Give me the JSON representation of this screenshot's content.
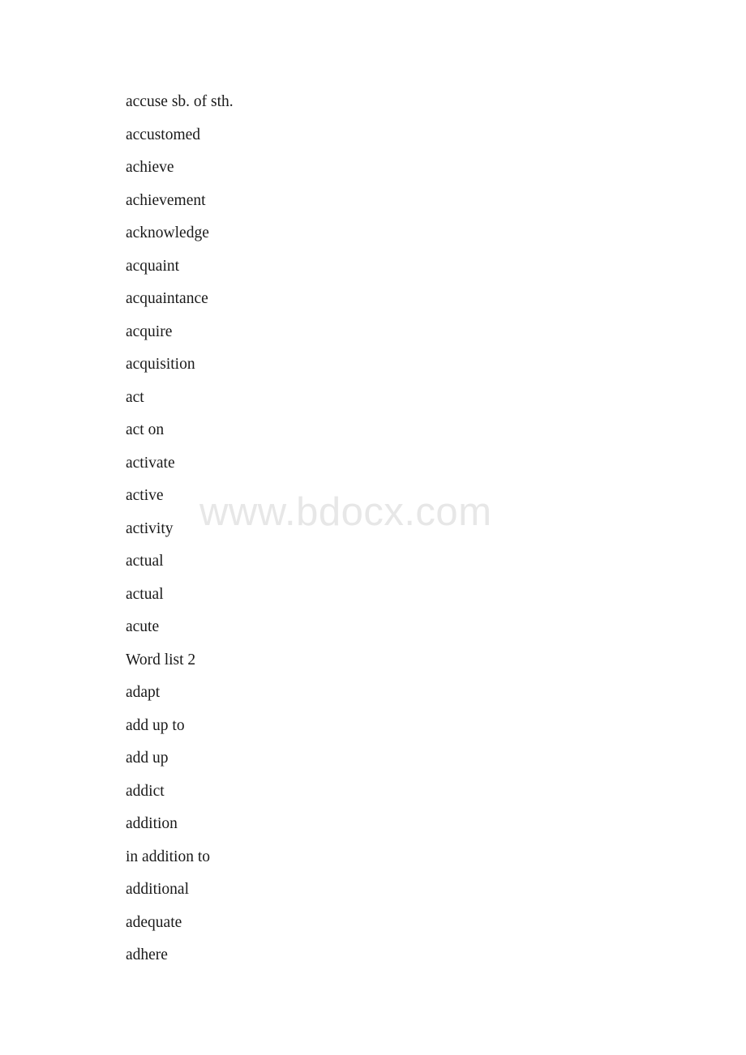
{
  "document": {
    "background_color": "#ffffff",
    "text_color": "#1a1a1a"
  },
  "watermark": {
    "text": "www.bdocx.com",
    "color": "#e7e7e7"
  },
  "word_list": {
    "entries": [
      {
        "text": "accuse sb. of sth."
      },
      {
        "text": "accustomed"
      },
      {
        "text": "achieve"
      },
      {
        "text": "achievement"
      },
      {
        "text": "acknowledge"
      },
      {
        "text": "acquaint"
      },
      {
        "text": "acquaintance"
      },
      {
        "text": "acquire"
      },
      {
        "text": "acquisition"
      },
      {
        "text": "act"
      },
      {
        "text": "act on"
      },
      {
        "text": "activate"
      },
      {
        "text": "active"
      },
      {
        "text": "activity"
      },
      {
        "text": "actual"
      },
      {
        "text": "actual"
      },
      {
        "text": "acute"
      },
      {
        "text": "Word list 2"
      },
      {
        "text": "adapt"
      },
      {
        "text": "add up to"
      },
      {
        "text": "add up"
      },
      {
        "text": "addict"
      },
      {
        "text": "addition"
      },
      {
        "text": "in addition to"
      },
      {
        "text": "additional"
      },
      {
        "text": "adequate"
      },
      {
        "text": "adhere"
      }
    ]
  }
}
